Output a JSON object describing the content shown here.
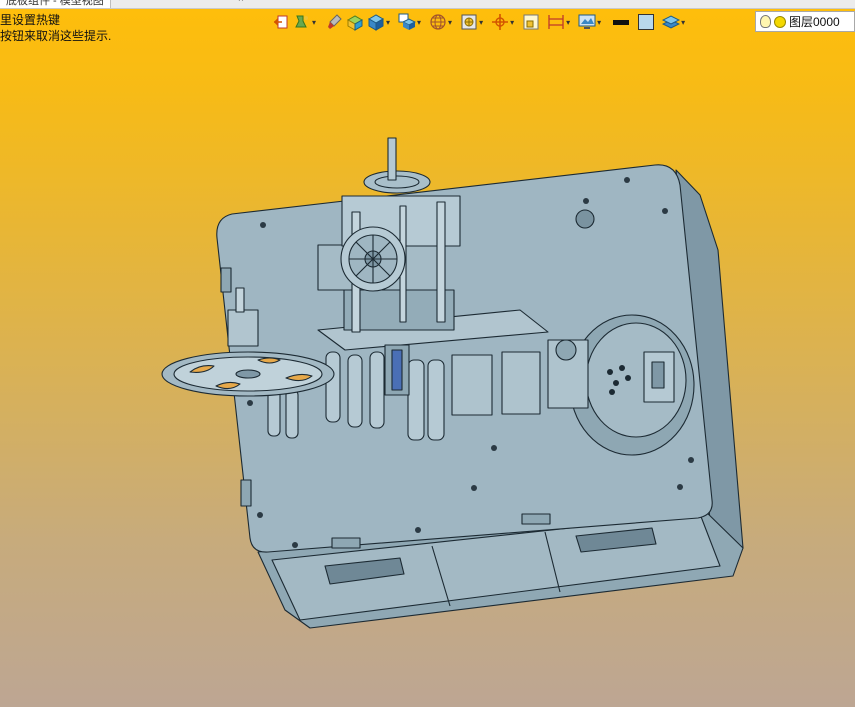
{
  "window": {
    "tab_title": "底板组件 - 模型视图",
    "close_glyph": "×"
  },
  "hints": {
    "line1": "里设置热键",
    "line2": "按钮来取消这些提示."
  },
  "toolbar": {
    "items": [
      {
        "icon": "exit-icon",
        "has_dropdown": false
      },
      {
        "icon": "pour-icon",
        "has_dropdown": true
      },
      {
        "icon": "brush-icon",
        "has_dropdown": false
      },
      {
        "icon": "box-green-icon",
        "has_dropdown": false
      },
      {
        "icon": "cube-icon",
        "has_dropdown": true
      },
      {
        "icon": "cube-display-icon",
        "has_dropdown": true
      },
      {
        "icon": "wireframe-sphere-icon",
        "has_dropdown": true
      },
      {
        "icon": "view-frame-icon",
        "has_dropdown": true
      },
      {
        "icon": "origin-axes-icon",
        "has_dropdown": true
      },
      {
        "icon": "section-icon",
        "has_dropdown": false
      },
      {
        "icon": "dimension-icon",
        "has_dropdown": true
      },
      {
        "icon": "display-monitor-icon",
        "has_dropdown": true
      },
      {
        "icon": "line-color-icon",
        "has_dropdown": false
      },
      {
        "icon": "fill-color-icon",
        "has_dropdown": false
      },
      {
        "icon": "layers-icon",
        "has_dropdown": true
      }
    ],
    "dropdown_glyph": "▾"
  },
  "layer": {
    "label": "图层0000"
  },
  "colors": {
    "background_top": "#ffbe0a",
    "background_bottom": "#bda693",
    "model_face": "#9fb6c2",
    "model_edge": "#1c2a33"
  }
}
